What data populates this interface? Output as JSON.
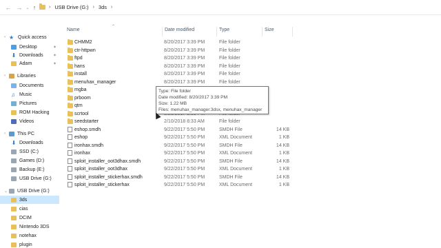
{
  "address": {
    "crumbs": [
      "USB Drive (G:)",
      "3ds"
    ]
  },
  "columns": {
    "name": "Name",
    "date": "Date modified",
    "type": "Type",
    "size": "Size"
  },
  "sidebar": {
    "items": [
      {
        "label": "Quick access",
        "icon": "star-icon"
      },
      {
        "label": "Desktop",
        "icon": "desktop-icon",
        "pinned": true
      },
      {
        "label": "Downloads",
        "icon": "download-icon",
        "pinned": true
      },
      {
        "label": "Adam",
        "icon": "user-folder-icon",
        "pinned": true
      },
      {
        "label": "Libraries",
        "icon": "library-icon"
      },
      {
        "label": "Documents",
        "icon": "documents-icon"
      },
      {
        "label": "Music",
        "icon": "music-icon"
      },
      {
        "label": "Pictures",
        "icon": "pictures-icon"
      },
      {
        "label": "ROM Hacking",
        "icon": "folder-icon"
      },
      {
        "label": "Videos",
        "icon": "videos-icon"
      },
      {
        "label": "This PC",
        "icon": "computer-icon"
      },
      {
        "label": "Downloads",
        "icon": "download-icon"
      },
      {
        "label": "SSD (C:)",
        "icon": "drive-icon"
      },
      {
        "label": "Games (D:)",
        "icon": "drive-icon"
      },
      {
        "label": "Backup (E:)",
        "icon": "drive-icon"
      },
      {
        "label": "USB Drive (G:)",
        "icon": "usb-drive-icon"
      },
      {
        "label": "USB Drive (G:)",
        "icon": "usb-drive-icon"
      },
      {
        "label": "3ds",
        "icon": "folder-icon",
        "selected": true
      },
      {
        "label": "cias",
        "icon": "folder-icon"
      },
      {
        "label": "DCIM",
        "icon": "folder-icon"
      },
      {
        "label": "Nintendo 3DS",
        "icon": "folder-icon"
      },
      {
        "label": "notehax",
        "icon": "folder-icon"
      },
      {
        "label": "plugin",
        "icon": "folder-icon"
      }
    ]
  },
  "files": [
    {
      "name": "CHMM2",
      "date": "8/20/2017 3:39 PM",
      "type": "File folder",
      "size": ""
    },
    {
      "name": "ctr-httpwn",
      "date": "8/20/2017 3:39 PM",
      "type": "File folder",
      "size": ""
    },
    {
      "name": "ftpd",
      "date": "8/20/2017 3:39 PM",
      "type": "File folder",
      "size": ""
    },
    {
      "name": "hans",
      "date": "8/20/2017 3:39 PM",
      "type": "File folder",
      "size": ""
    },
    {
      "name": "install",
      "date": "8/20/2017 3:39 PM",
      "type": "File folder",
      "size": ""
    },
    {
      "name": "menuhax_manager",
      "date": "8/20/2017 3:39 PM",
      "type": "File folder",
      "size": ""
    },
    {
      "name": "mgba",
      "date": "",
      "type": "",
      "size": ""
    },
    {
      "name": "prboom",
      "date": "",
      "type": "",
      "size": ""
    },
    {
      "name": "qtm",
      "date": "",
      "type": "",
      "size": ""
    },
    {
      "name": "scrtool",
      "date": "8/20/2017 3:39 PM",
      "type": "File folder",
      "size": ""
    },
    {
      "name": "seedstarter",
      "date": "2/10/2018 8:33 AM",
      "type": "File folder",
      "size": ""
    },
    {
      "name": "eshop.smdh",
      "date": "9/22/2017 5:50 PM",
      "type": "SMDH File",
      "size": "14 KB"
    },
    {
      "name": "eshop",
      "date": "9/22/2017 5:50 PM",
      "type": "XML Document",
      "size": "1 KB"
    },
    {
      "name": "ironhax.smdh",
      "date": "9/22/2017 5:50 PM",
      "type": "SMDH File",
      "size": "14 KB"
    },
    {
      "name": "ironhax",
      "date": "9/22/2017 5:50 PM",
      "type": "XML Document",
      "size": "1 KB"
    },
    {
      "name": "sploit_installer_oot3dhax.smdh",
      "date": "9/22/2017 5:50 PM",
      "type": "SMDH File",
      "size": "14 KB"
    },
    {
      "name": "sploit_installer_oot3dhax",
      "date": "9/22/2017 5:50 PM",
      "type": "XML Document",
      "size": "1 KB"
    },
    {
      "name": "sploit_installer_stickerhax.smdh",
      "date": "9/22/2017 5:50 PM",
      "type": "SMDH File",
      "size": "14 KB"
    },
    {
      "name": "sploit_installer_stickerhax",
      "date": "9/22/2017 5:50 PM",
      "type": "XML Document",
      "size": "1 KB"
    }
  ],
  "tooltip": {
    "line1": "Type: File folder",
    "line2": "Date modified: 8/20/2017 3:39 PM",
    "line3": "Size: 1.22 MB",
    "line4": "Files: menuhax_manager.3dsx, menuhax_manager"
  }
}
